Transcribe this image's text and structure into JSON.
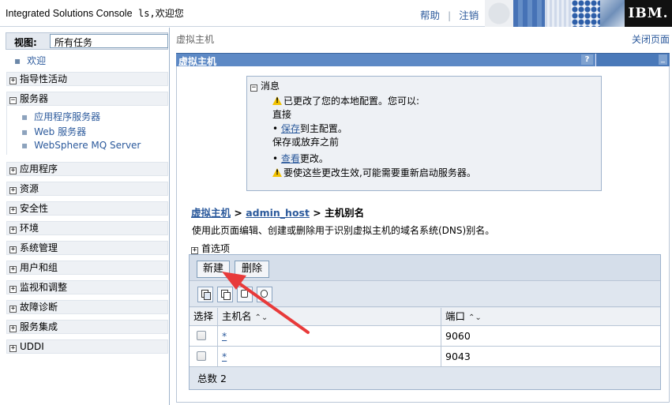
{
  "banner": {
    "title": "Integrated Solutions Console",
    "user": "ls,欢迎您",
    "help": "帮助",
    "separator": "|",
    "logout": "注销",
    "logo": "IBM."
  },
  "nav": {
    "view_label": "视图:",
    "view_value": "所有任务",
    "welcome": "欢迎",
    "items": [
      {
        "label": "指导性活动",
        "state": "+"
      },
      {
        "label": "服务器",
        "state": "−"
      },
      {
        "label": "应用程序",
        "state": "+"
      },
      {
        "label": "资源",
        "state": "+"
      },
      {
        "label": "安全性",
        "state": "+"
      },
      {
        "label": "环境",
        "state": "+"
      },
      {
        "label": "系统管理",
        "state": "+"
      },
      {
        "label": "用户和组",
        "state": "+"
      },
      {
        "label": "监视和调整",
        "state": "+"
      },
      {
        "label": "故障诊断",
        "state": "+"
      },
      {
        "label": "服务集成",
        "state": "+"
      },
      {
        "label": "UDDI",
        "state": "+"
      }
    ],
    "server_sub": [
      "应用程序服务器",
      "Web 服务器",
      "WebSphere MQ Server"
    ]
  },
  "content": {
    "crumb": "虚拟主机",
    "close_page": "关闭页面",
    "portlet_title": "虚拟主机",
    "help_glyph": "?",
    "min_glyph": "_",
    "messages": {
      "header": "消息",
      "line1": "已更改了您的本地配置。您可以:",
      "line2": "直接",
      "save_link": "保存",
      "line3_rest": "到主配置。",
      "line4": "保存或放弃之前",
      "review_link": "查看",
      "line5_rest": "更改。",
      "line6": "要使这些更改生效,可能需要重新启动服务器。"
    },
    "path": {
      "link1": "虚拟主机",
      "sep": " > ",
      "link2": "admin_host",
      "current": "主机别名"
    },
    "description": "使用此页面编辑、创建或删除用于识别虚拟主机的域名系统(DNS)别名。",
    "preferences": "首选项",
    "buttons": {
      "new": "新建",
      "delete": "删除"
    },
    "table": {
      "headers": {
        "select": "选择",
        "host": "主机名",
        "port": "端口"
      },
      "rows": [
        {
          "host": "*",
          "port": "9060"
        },
        {
          "host": "*",
          "port": "9043"
        }
      ],
      "total": "总数 2"
    }
  },
  "colors": {
    "portlet_header": "#5d89c5",
    "link": "#2c5a9c",
    "annotation_arrow": "#e83a3a"
  }
}
